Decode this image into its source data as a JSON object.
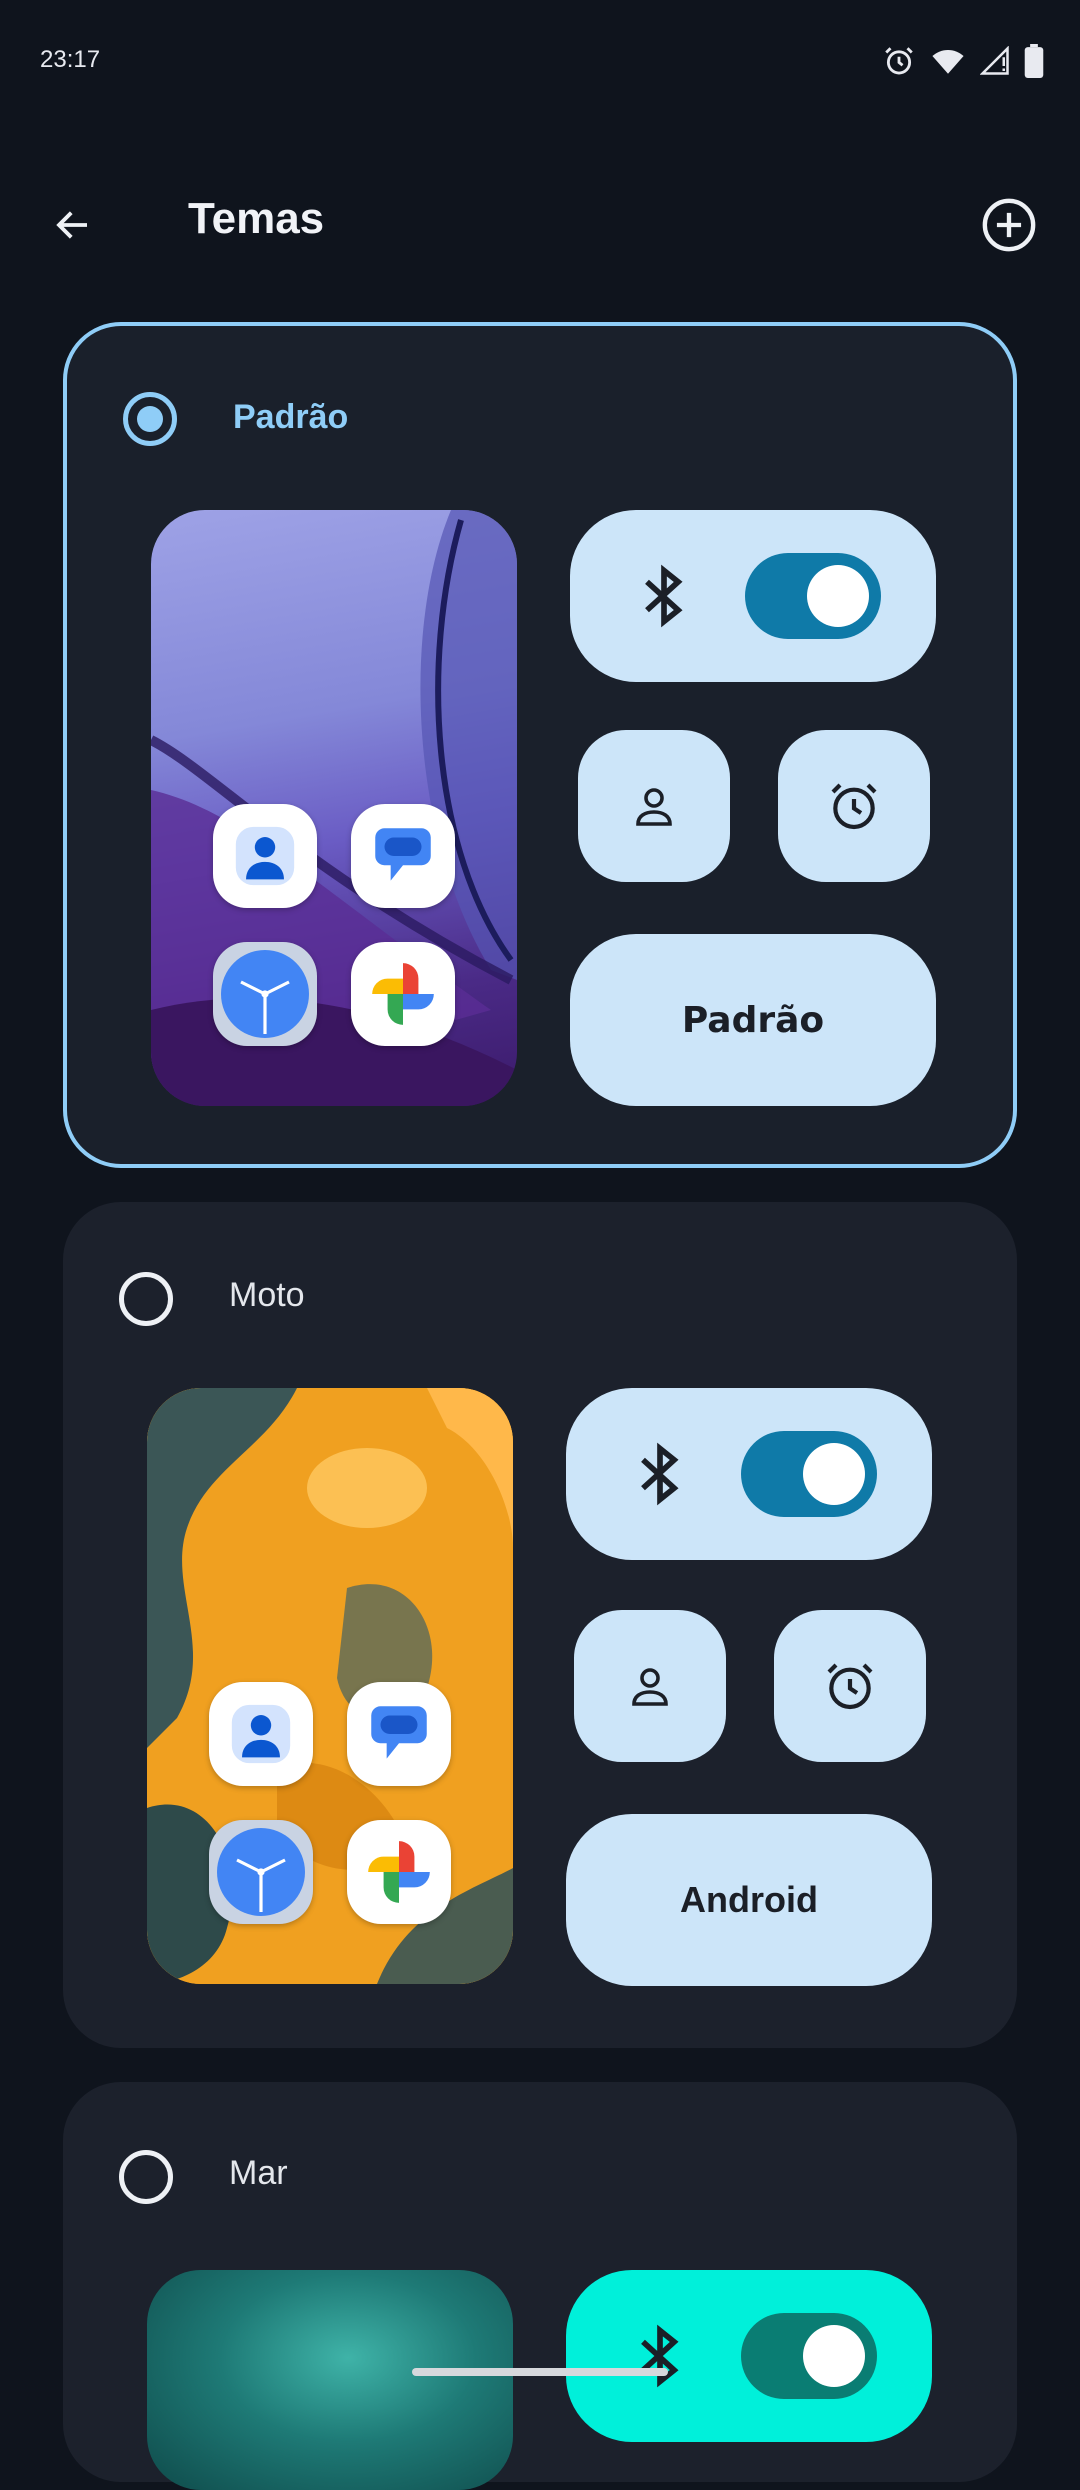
{
  "status_bar": {
    "time": "23:17"
  },
  "app_bar": {
    "title": "Temas"
  },
  "themes": [
    {
      "name": "Padrão",
      "selected": true,
      "font_label": "Padrão",
      "accent": "#cce5f9",
      "toggle_color": "#0f7aa8"
    },
    {
      "name": "Moto",
      "selected": false,
      "font_label": "Android",
      "accent": "#cce5f9",
      "toggle_color": "#0f7aa8"
    },
    {
      "name": "Mar",
      "selected": false,
      "accent": "#00f0da",
      "toggle_color": "#0a7d73"
    }
  ],
  "icons": [
    "back-arrow-icon",
    "add-circle-icon",
    "alarm-icon",
    "wifi-icon",
    "signal-icon",
    "battery-icon",
    "bluetooth-icon",
    "person-icon",
    "alarm-clock-icon",
    "contacts-app-icon",
    "messages-app-icon",
    "clock-app-icon",
    "photos-app-icon"
  ],
  "colors": {
    "background": "#0f141d",
    "card": "#1c212c",
    "selected_border": "#8fcdf7"
  }
}
